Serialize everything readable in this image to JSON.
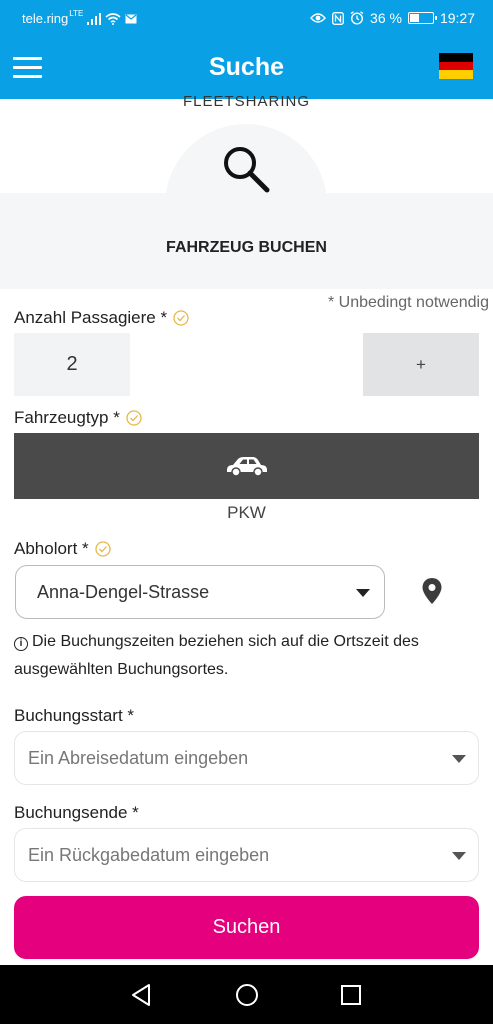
{
  "status_bar": {
    "carrier": "tele.ring",
    "network": "LTE",
    "battery": "36 %",
    "battery_level": 0.36,
    "time": "19:27"
  },
  "app_bar": {
    "title": "Suche",
    "menu_icon": "hamburger-menu-icon",
    "language_flag": "germany-flag-icon",
    "color": "#0aa0e6"
  },
  "hero": {
    "brand": "FLEETSHARING",
    "icon": "search-icon",
    "heading": "FAHRZEUG BUCHEN"
  },
  "form": {
    "required_note": "* Unbedingt notwendig",
    "passengers": {
      "label": "Anzahl Passagiere *",
      "value": "2",
      "increment_label": "+"
    },
    "vehicle_type": {
      "label": "Fahrzeugtyp *",
      "icon": "car-icon",
      "value": "PKW"
    },
    "pickup": {
      "label": "Abholort *",
      "value": "Anna-Dengel-Strasse",
      "pin_icon": "location-pin-icon"
    },
    "info_text": "Die Buchungszeiten beziehen sich auf die Ortszeit des ausgewählten Buchungsortes.",
    "booking_start": {
      "label": "Buchungsstart *",
      "placeholder": "Ein Abreisedatum eingeben"
    },
    "booking_end": {
      "label": "Buchungsende *",
      "placeholder": "Ein Rückgabedatum eingeben"
    },
    "submit_label": "Suchen",
    "accent_color": "#e5007d"
  },
  "nav_bar": {
    "back": "back-triangle-icon",
    "home": "home-circle-icon",
    "recents": "recents-square-icon"
  }
}
